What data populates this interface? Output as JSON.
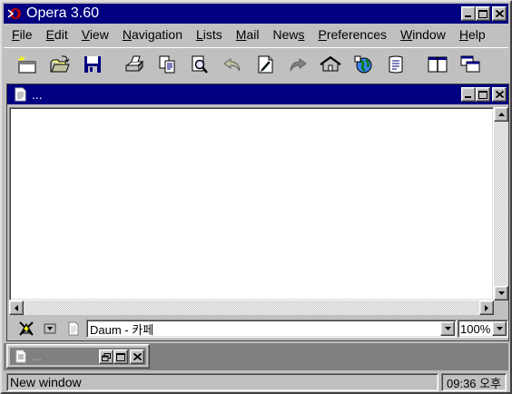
{
  "app": {
    "title": "Opera 3.60",
    "logo_icon": "opera-logo-icon"
  },
  "menu": [
    {
      "label": "File",
      "acc": "F",
      "rest": "ile"
    },
    {
      "label": "Edit",
      "acc": "E",
      "rest": "dit"
    },
    {
      "label": "View",
      "acc": "V",
      "rest": "iew"
    },
    {
      "label": "Navigation",
      "acc": "N",
      "rest": "avigation"
    },
    {
      "label": "Lists",
      "acc": "L",
      "rest": "ists"
    },
    {
      "label": "Mail",
      "acc": "M",
      "rest": "ail"
    },
    {
      "label": "News",
      "pre": "New",
      "acc": "s",
      "rest": ""
    },
    {
      "label": "Preferences",
      "acc": "P",
      "rest": "references"
    },
    {
      "label": "Window",
      "acc": "W",
      "rest": "indow"
    },
    {
      "label": "Help",
      "acc": "H",
      "rest": "elp"
    }
  ],
  "toolbar": {
    "buttons": [
      "new-window-icon",
      "open-folder-icon",
      "save-disk-icon",
      "print-icon",
      "copy-icon",
      "find-icon",
      "back-arrow-icon",
      "edit-document-icon",
      "forward-arrow-icon",
      "home-icon",
      "globe-icon",
      "hotlist-icon",
      "split-pane-icon",
      "cascade-windows-icon"
    ]
  },
  "document": {
    "title": "...",
    "address": "Daum - 카페",
    "zoom": "100%"
  },
  "minimized_doc": {
    "title": "..."
  },
  "status": {
    "text": "New window",
    "clock": "09:36 오후"
  }
}
